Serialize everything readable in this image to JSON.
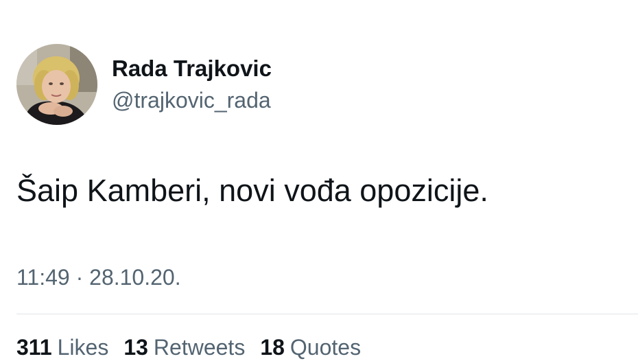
{
  "author": {
    "display_name": "Rada Trajkovic",
    "handle": "@trajkovic_rada"
  },
  "tweet": {
    "text": "Šaip Kamberi, novi vođa opozicije.",
    "time": "11:49",
    "separator": "·",
    "date": "28.10.20."
  },
  "stats": {
    "likes_count": "311",
    "likes_label": "Likes",
    "retweets_count": "13",
    "retweets_label": "Retweets",
    "quotes_count": "18",
    "quotes_label": "Quotes"
  }
}
